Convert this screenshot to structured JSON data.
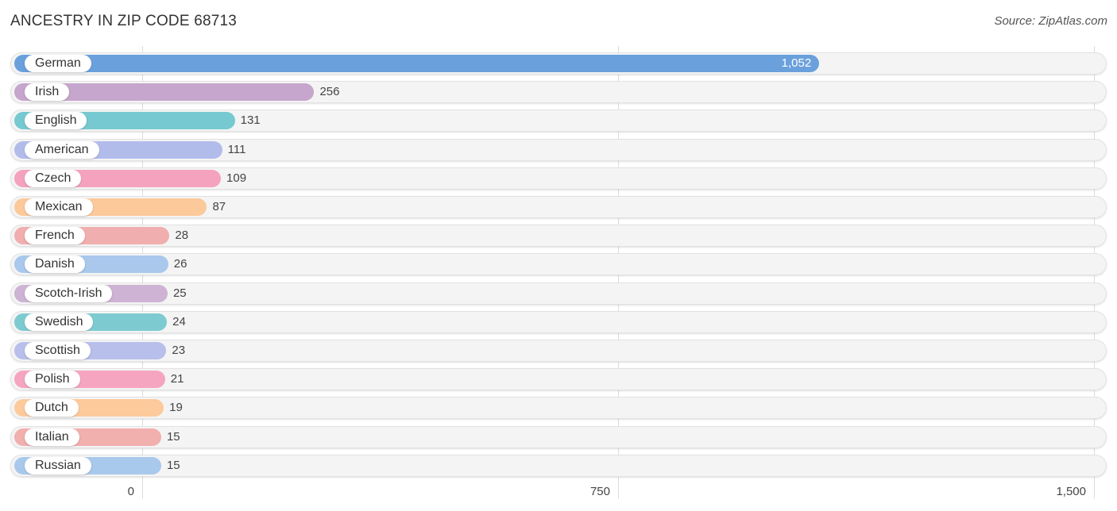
{
  "header": {
    "title": "ANCESTRY IN ZIP CODE 68713",
    "source": "Source: ZipAtlas.com"
  },
  "chart_data": {
    "type": "bar",
    "orientation": "horizontal",
    "title": "ANCESTRY IN ZIP CODE 68713",
    "xlabel": "",
    "ylabel": "",
    "xlim": [
      0,
      1500
    ],
    "grid": true,
    "x_ticks": [
      0,
      750,
      1500
    ],
    "x_tick_labels": [
      "0",
      "750",
      "1,500"
    ],
    "categories": [
      "German",
      "Irish",
      "English",
      "American",
      "Czech",
      "Mexican",
      "French",
      "Danish",
      "Scotch-Irish",
      "Swedish",
      "Scottish",
      "Polish",
      "Dutch",
      "Italian",
      "Russian"
    ],
    "values": [
      1052,
      256,
      131,
      111,
      109,
      87,
      28,
      26,
      25,
      24,
      23,
      21,
      19,
      15,
      15
    ],
    "value_labels": [
      "1,052",
      "256",
      "131",
      "111",
      "109",
      "87",
      "28",
      "26",
      "25",
      "24",
      "23",
      "21",
      "19",
      "15",
      "15"
    ],
    "colors": [
      "#6aa0dc",
      "#c6a6cc",
      "#76c9d0",
      "#b2bceb",
      "#f4a2bd",
      "#fcc99b",
      "#f0aeae",
      "#a9c8ec",
      "#ceb3d4",
      "#7dcbd0",
      "#b8bfeb",
      "#f5a5c0",
      "#fdca9c",
      "#f1afae",
      "#a9c9ec"
    ]
  }
}
